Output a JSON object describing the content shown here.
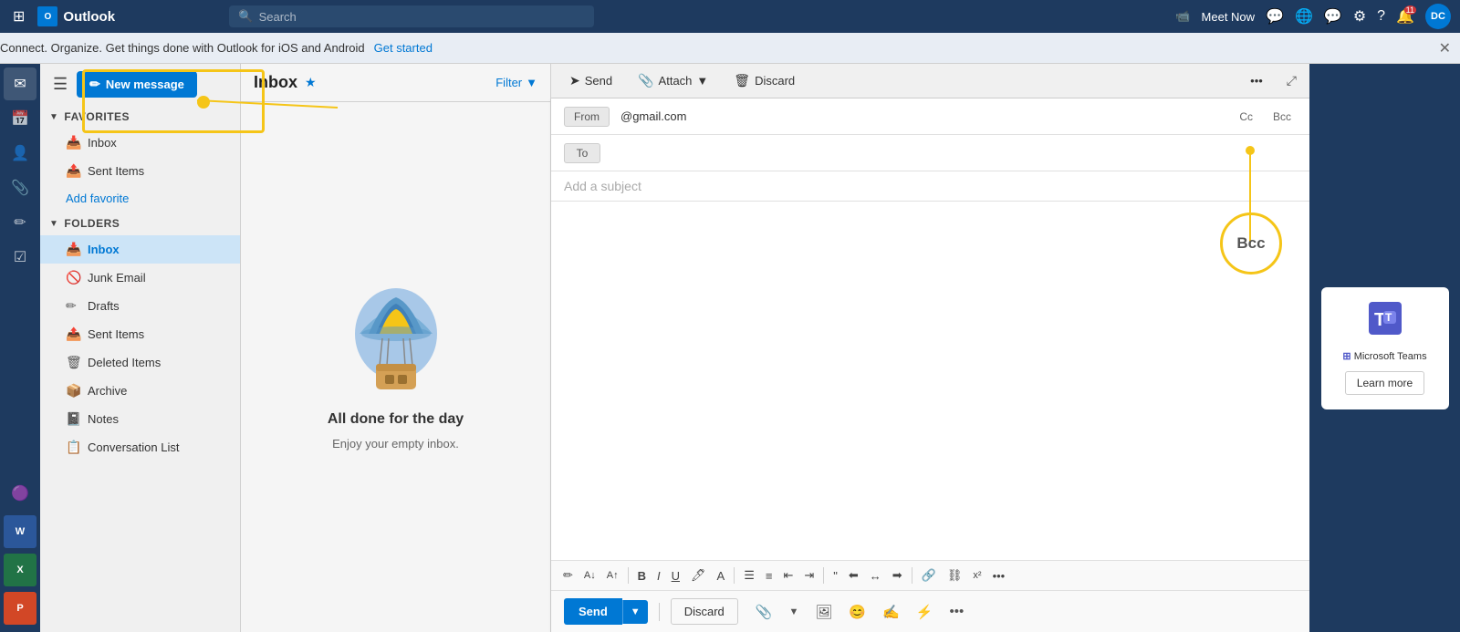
{
  "titlebar": {
    "app_name": "Outlook",
    "search_placeholder": "Search",
    "meet_now": "Meet Now",
    "avatar_initials": "DC"
  },
  "banner": {
    "message": "Connect. Organize. Get things done with Outlook for iOS and Android",
    "cta": "Get started"
  },
  "sidebar": {
    "items": [
      {
        "icon": "✉",
        "label": "Mail",
        "active": true
      },
      {
        "icon": "📅",
        "label": "Calendar"
      },
      {
        "icon": "👤",
        "label": "People"
      },
      {
        "icon": "📎",
        "label": "Files"
      },
      {
        "icon": "✏",
        "label": "Notes"
      },
      {
        "icon": "📝",
        "label": "Tasks"
      },
      {
        "icon": "🔲",
        "label": "OneNote"
      },
      {
        "icon": "⊞",
        "label": "Word"
      },
      {
        "icon": "📊",
        "label": "Excel"
      },
      {
        "icon": "🎯",
        "label": "PowerPoint"
      },
      {
        "icon": "🟣",
        "label": "OneNote2"
      }
    ]
  },
  "folders": {
    "new_message_label": "New message",
    "favorites_label": "Favorites",
    "folders_label": "Folders",
    "favorites": [
      {
        "icon": "📥",
        "label": "Inbox",
        "active": false
      },
      {
        "icon": "📤",
        "label": "Sent Items",
        "active": false
      }
    ],
    "add_favorite": "Add favorite",
    "folder_list": [
      {
        "icon": "📥",
        "label": "Inbox",
        "active": true
      },
      {
        "icon": "🚫",
        "label": "Junk Email",
        "active": false
      },
      {
        "icon": "✏",
        "label": "Drafts",
        "active": false
      },
      {
        "icon": "📤",
        "label": "Sent Items",
        "active": false
      },
      {
        "icon": "🗑",
        "label": "Deleted Items",
        "active": false
      },
      {
        "icon": "📦",
        "label": "Archive",
        "active": false
      },
      {
        "icon": "📓",
        "label": "Notes",
        "active": false
      },
      {
        "icon": "📋",
        "label": "Conversation List",
        "active": false
      }
    ]
  },
  "message_list": {
    "title": "Inbox",
    "filter_label": "Filter",
    "empty_title": "All done for the day",
    "empty_subtitle": "Enjoy your empty inbox."
  },
  "compose": {
    "toolbar": {
      "send_label": "Send",
      "attach_label": "Attach",
      "discard_label": "Discard",
      "more_label": "..."
    },
    "from_label": "From",
    "from_value": "@gmail.com",
    "to_label": "To",
    "cc_label": "Cc",
    "bcc_label": "Bcc",
    "subject_placeholder": "Add a subject",
    "send_btn": "Send",
    "discard_btn": "Discard"
  },
  "ad": {
    "logo": "🟦",
    "title": "Microsoft Teams",
    "learn_more": "Learn more"
  }
}
